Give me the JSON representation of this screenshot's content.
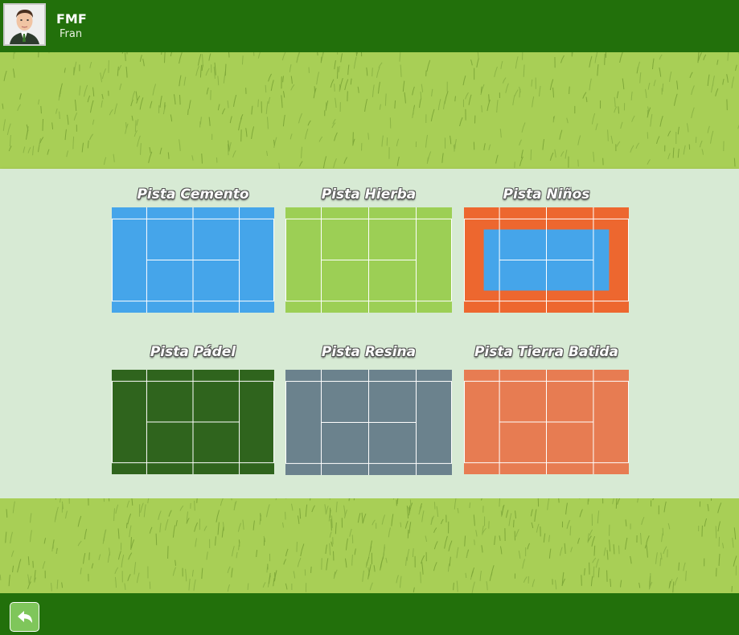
{
  "header": {
    "user_name": "FMF",
    "user_subtitle": "Fran",
    "avatar_icon": "person-avatar-icon"
  },
  "courts": [
    {
      "title": "Pista Cemento",
      "surface": "#45a5ea",
      "outer": "#45a5ea",
      "type": "tennis"
    },
    {
      "title": "Pista Hierba",
      "surface": "#9ccf55",
      "outer": "#9ccf55",
      "type": "tennis"
    },
    {
      "title": "Pista Niños",
      "surface": "#45a5ea",
      "outer": "#ed672f",
      "type": "kids"
    },
    {
      "title": "Pista Pádel",
      "surface": "#2f641d",
      "outer": "#2f641d",
      "type": "tennis"
    },
    {
      "title": "Pista Resina",
      "surface": "#6b828d",
      "outer": "#6b828d",
      "type": "tennis"
    },
    {
      "title": "Pista Tierra Batida",
      "surface": "#e77c52",
      "outer": "#e77c52",
      "type": "tennis"
    }
  ],
  "footer": {
    "back_icon": "back-arrow-icon"
  },
  "colors": {
    "bar_green": "#22700b",
    "panel_bg": "#d7ead4",
    "grass": "#a8cf56"
  }
}
